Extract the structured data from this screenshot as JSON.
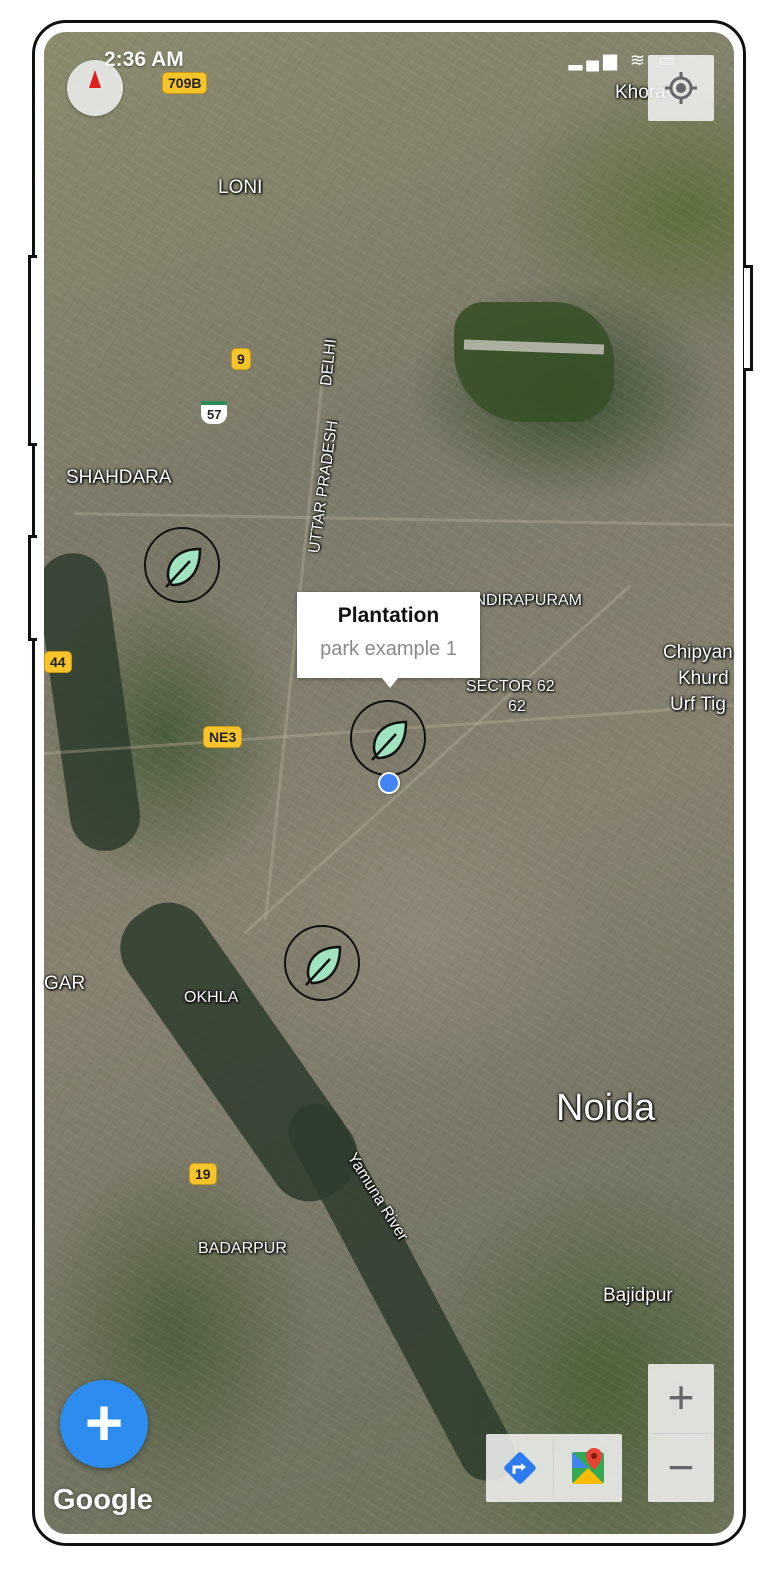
{
  "status_bar": {
    "time": "2:36 AM",
    "icons": "▂▄▆ ≋ ▭"
  },
  "map": {
    "labels": {
      "loni": "LONI",
      "shahdara": "SHAHDARA",
      "delhi": "DELHI",
      "uttar_pradesh": "UTTAR PRADESH",
      "indirapuram": "INDIRAPURAM",
      "sector62": "SECTOR 62",
      "sector62_num": "62",
      "chipyana_1": "Chipyan",
      "chipyana_2": "Khurd",
      "chipyana_3": "Urf Tig",
      "gar": "GAR",
      "okhla": "OKHLA",
      "noida": "Noida",
      "yamuna": "Yamuna River",
      "badarpur": "BADARPUR",
      "bajidpur": "Bajidpur",
      "khora": "Khora"
    },
    "shields": {
      "r709b": "709B",
      "r9": "9",
      "r57": "57",
      "r44": "44",
      "ne3": "NE3",
      "r19": "19"
    }
  },
  "callout": {
    "title": "Plantation",
    "subtitle": "park example 1"
  },
  "fab": {
    "label": "+"
  },
  "attribution": "Google",
  "zoom": {
    "in": "+",
    "out": "−"
  },
  "colors": {
    "marker_leaf": "#9fe3bf",
    "fab": "#2d8cf0",
    "my_location": "#4285f4"
  }
}
